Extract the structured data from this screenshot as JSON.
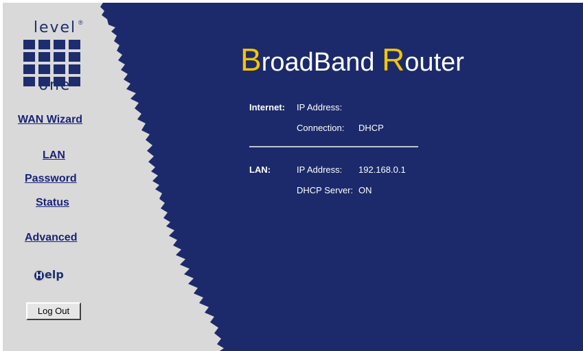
{
  "logo": {
    "top_text": "level",
    "bottom_text": "one",
    "registered": "®"
  },
  "nav": {
    "wan_wizard": "WAN Wizard",
    "lan": "LAN",
    "password": "Password",
    "status": "Status",
    "advanced": "Advanced"
  },
  "help": {
    "label": "elp",
    "circle_letter": "H"
  },
  "logout_label": "Log Out",
  "header": {
    "title_cap1": "B",
    "title_rest1": "roadBand ",
    "title_cap2": "R",
    "title_rest2": "outer"
  },
  "status": {
    "internet": {
      "label": "Internet:",
      "ip_label": "IP Address:",
      "ip_value": "",
      "connection_label": "Connection:",
      "connection_value": "DHCP"
    },
    "lan": {
      "label": "LAN:",
      "ip_label": "IP Address:",
      "ip_value": "192.168.0.1",
      "dhcp_label": "DHCP Server:",
      "dhcp_value": "ON"
    }
  },
  "colors": {
    "background": "#1c2a6b",
    "sidebar": "#d9d9d9",
    "accent": "#f5c400",
    "link": "#1a2277"
  }
}
